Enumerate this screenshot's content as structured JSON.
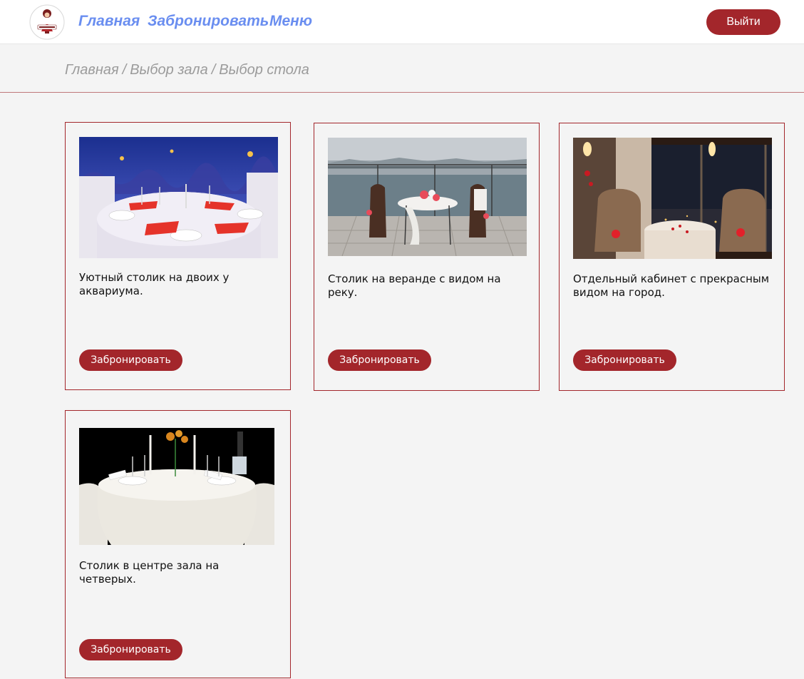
{
  "nav": {
    "home": "Главная",
    "book": "Забронировать",
    "menu": "Меню",
    "logout": "Выйти"
  },
  "breadcrumb": [
    "Главная",
    "Выбор зала",
    "Выбор стола"
  ],
  "tables": [
    {
      "photo": "aquarium-table-photo",
      "description": "Уютный столик на двоих у аквариума.",
      "button": "Забронировать"
    },
    {
      "photo": "veranda-table-photo",
      "description": "Столик на веранде с видом на реку.",
      "button": "Забронировать"
    },
    {
      "photo": "private-room-photo",
      "description": "Отдельный кабинет с прекрасным видом на город.",
      "button": "Забронировать"
    },
    {
      "photo": "center-table-photo",
      "description": "Столик в центре зала на четверых.",
      "button": "Забронировать"
    }
  ],
  "colors": {
    "accent": "#a3262b",
    "nav_link": "#6a8ef0",
    "breadcrumb": "#9b9b9b",
    "background": "#f4f4f4"
  }
}
